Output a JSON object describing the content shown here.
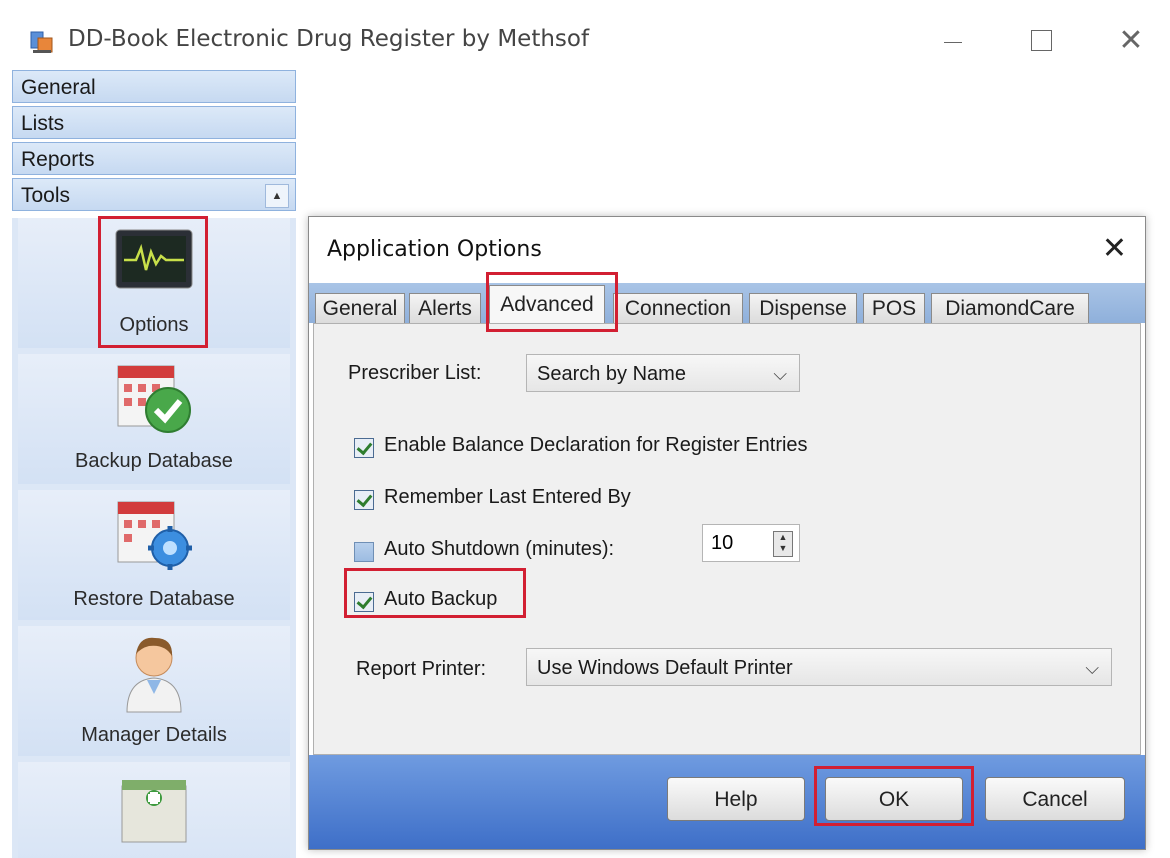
{
  "window": {
    "title": "DD-Book Electronic Drug Register by Methsof"
  },
  "nav": {
    "sections": [
      {
        "label": "General"
      },
      {
        "label": "Lists"
      },
      {
        "label": "Reports"
      },
      {
        "label": "Tools"
      }
    ],
    "tools": [
      {
        "label": "Options",
        "icon": "options-monitor-icon"
      },
      {
        "label": "Backup Database",
        "icon": "backup-database-icon"
      },
      {
        "label": "Restore Database",
        "icon": "restore-database-icon"
      },
      {
        "label": "Manager Details",
        "icon": "manager-details-icon"
      },
      {
        "label": "",
        "icon": "pharmacy-building-icon"
      }
    ]
  },
  "dialog": {
    "title": "Application Options",
    "tabs": [
      {
        "label": "General"
      },
      {
        "label": "Alerts"
      },
      {
        "label": "Advanced"
      },
      {
        "label": "Connection"
      },
      {
        "label": "Dispense"
      },
      {
        "label": "POS"
      },
      {
        "label": "DiamondCare"
      }
    ],
    "active_tab": "Advanced",
    "prescriber_list": {
      "label": "Prescriber List:",
      "value": "Search by Name"
    },
    "checkboxes": [
      {
        "label": "Enable Balance Declaration for Register Entries",
        "checked": true
      },
      {
        "label": "Remember Last Entered By",
        "checked": true
      },
      {
        "label": "Auto Shutdown (minutes):",
        "checked": false
      },
      {
        "label": "Auto Backup",
        "checked": true
      }
    ],
    "auto_shutdown_minutes": "10",
    "report_printer": {
      "label": "Report Printer:",
      "value": "Use Windows Default Printer"
    },
    "buttons": {
      "help": "Help",
      "ok": "OK",
      "cancel": "Cancel"
    }
  },
  "colors": {
    "highlight_box": "#d21f32",
    "footer_blue": "#4a7bd0",
    "nav_blue": "#c6d9f1"
  }
}
